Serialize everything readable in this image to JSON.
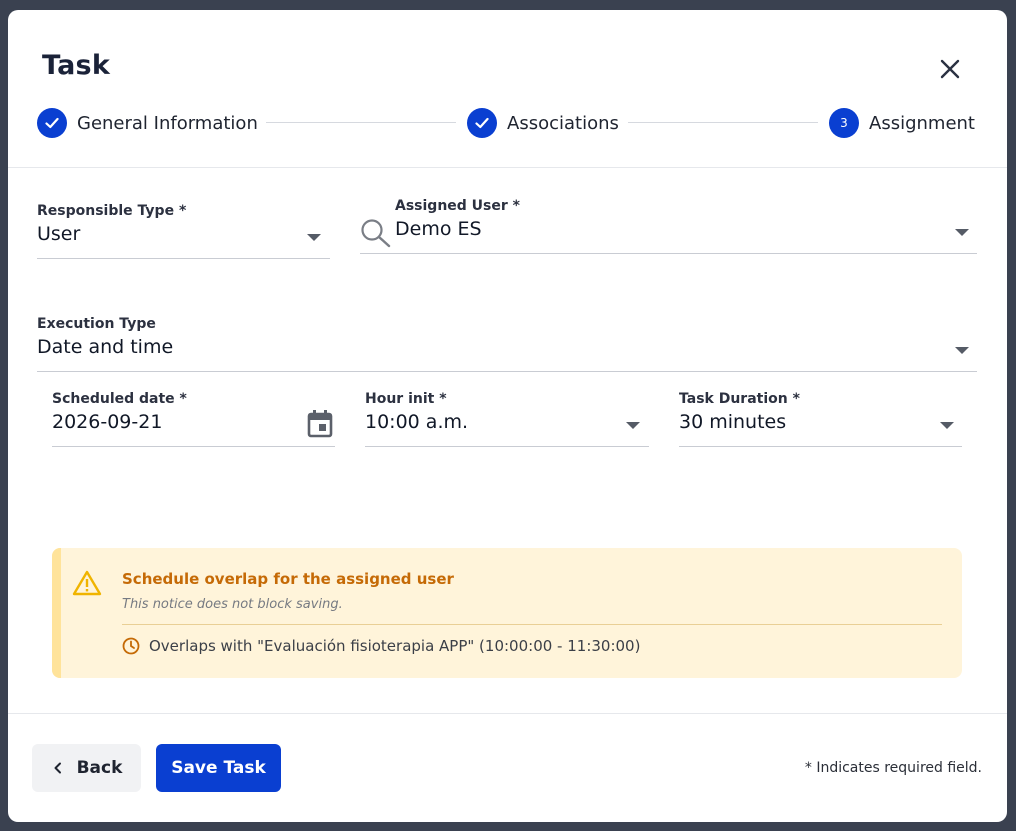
{
  "modal": {
    "title": "Task",
    "close_icon": "close-icon"
  },
  "stepper": {
    "steps": [
      {
        "label": "General Information",
        "state": "completed",
        "icon": "check-icon"
      },
      {
        "label": "Associations",
        "state": "completed",
        "icon": "check-icon"
      },
      {
        "label": "Assignment",
        "state": "active",
        "number": "3"
      }
    ]
  },
  "form": {
    "responsible_type": {
      "label": "Responsible Type *",
      "value": "User"
    },
    "assigned_user": {
      "label": "Assigned User *",
      "value": "Demo ES",
      "icon": "search-icon"
    },
    "execution_type": {
      "label": "Execution Type",
      "value": "Date and time"
    },
    "scheduled_date": {
      "label": "Scheduled date *",
      "value": "2026-09-21",
      "icon": "calendar-icon"
    },
    "hour_init": {
      "label": "Hour init *",
      "value": "10:00 a.m."
    },
    "task_duration": {
      "label": "Task Duration *",
      "value": "30 minutes"
    }
  },
  "alert": {
    "title": "Schedule overlap for the assigned user",
    "subtitle": "This notice does not block saving.",
    "detail": "Overlaps with \"Evaluación fisioterapia APP\" (10:00:00 - 11:30:00)",
    "icon": "warning-icon",
    "detail_icon": "clock-icon"
  },
  "footer": {
    "back_label": "Back",
    "save_label": "Save Task",
    "required_note": "* Indicates required field."
  },
  "colors": {
    "primary": "#0a3fd1",
    "warning_bg": "#fff4da",
    "warning_text": "#c56a06"
  }
}
